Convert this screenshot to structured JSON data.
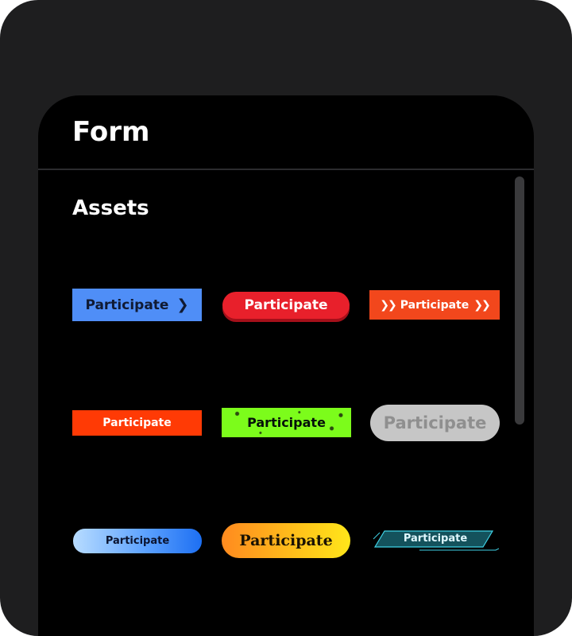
{
  "panel": {
    "title": "Form"
  },
  "section": {
    "title": "Assets"
  },
  "assets": [
    {
      "label": "Participate",
      "style": "blue-rect-chevron",
      "color": "#4f8ef7"
    },
    {
      "label": "Participate",
      "style": "red-pill-3d",
      "color": "#e8202b"
    },
    {
      "label": "Participate",
      "style": "orange-rect-double-arrows",
      "color": "#f2471c"
    },
    {
      "label": "Participate",
      "style": "orange-red-flat",
      "color": "#ff3a05"
    },
    {
      "label": "Participate",
      "style": "green-grunge",
      "color": "#7cfc1b"
    },
    {
      "label": "Participate",
      "style": "gray-pill-disabled",
      "color": "#c6c6c6"
    },
    {
      "label": "Participate",
      "style": "blue-gradient-pill",
      "color": "#5ea3ff"
    },
    {
      "label": "Participate",
      "style": "yellow-orange-gradient-pill",
      "color": "#ffc21a"
    },
    {
      "label": "Participate",
      "style": "teal-tech-parallelogram",
      "color": "#1b6b78"
    }
  ],
  "icons": {
    "chevron": "chevron-right-icon",
    "double_arrow": "double-chevron-right-icon"
  },
  "theme": {
    "device_bg": "#1e1e1f",
    "panel_bg": "#000000",
    "text": "#ffffff",
    "scrollbar": "#3a3a3c"
  }
}
